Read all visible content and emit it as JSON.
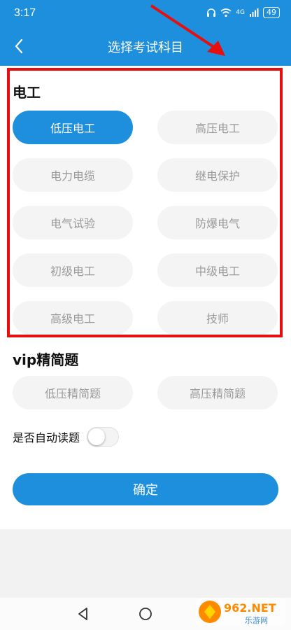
{
  "status": {
    "time": "3:17",
    "battery": "49",
    "network": "4G"
  },
  "header": {
    "title": "选择考试科目"
  },
  "electrician": {
    "title": "电工",
    "subjects": [
      "低压电工",
      "高压电工",
      "电力电缆",
      "继电保护",
      "电气试验",
      "防爆电气",
      "初级电工",
      "中级电工",
      "高级电工",
      "技师"
    ],
    "selected": "低压电工"
  },
  "vip": {
    "title": "vip精简题",
    "subjects": [
      "低压精简题",
      "高压精简题"
    ]
  },
  "auto_read": {
    "label": "是否自动读题",
    "enabled": false
  },
  "confirm": {
    "label": "确定"
  },
  "watermark": {
    "brand": "962.NET",
    "sub": "乐游网"
  },
  "colors": {
    "accent": "#1d8fdc",
    "highlight_box": "#e50f0f",
    "pill_bg": "#f4f4f4",
    "pill_text": "#9a9a9a"
  }
}
